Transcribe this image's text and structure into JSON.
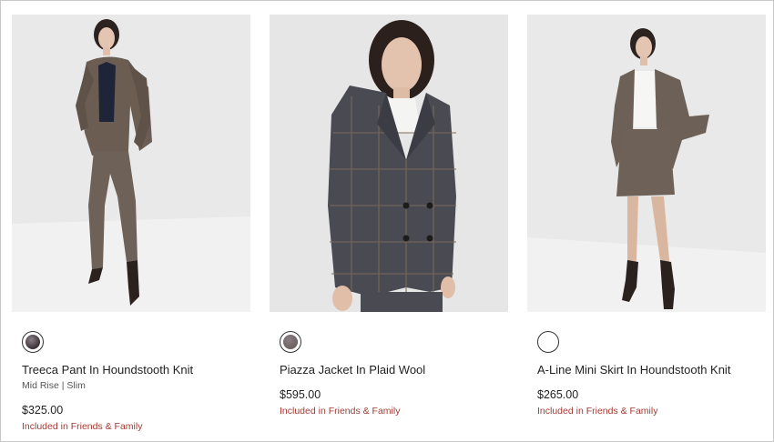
{
  "products": [
    {
      "name": "Treeca Pant In Houndstooth Knit",
      "sub": "Mid Rise | Slim",
      "price": "$325.00",
      "promo": "Included in Friends & Family",
      "swatch_color": "#3a3238"
    },
    {
      "name": "Piazza Jacket In Plaid Wool",
      "price": "$595.00",
      "promo": "Included in Friends & Family",
      "swatch_color": "#6b6260"
    },
    {
      "name": "A-Line Mini Skirt In Houndstooth Knit",
      "price": "$265.00",
      "promo": "Included in Friends & Family",
      "swatch_color": "#ffffff"
    }
  ],
  "colors": {
    "promo": "#a33a32",
    "photo_background": "#e9e9e9"
  }
}
